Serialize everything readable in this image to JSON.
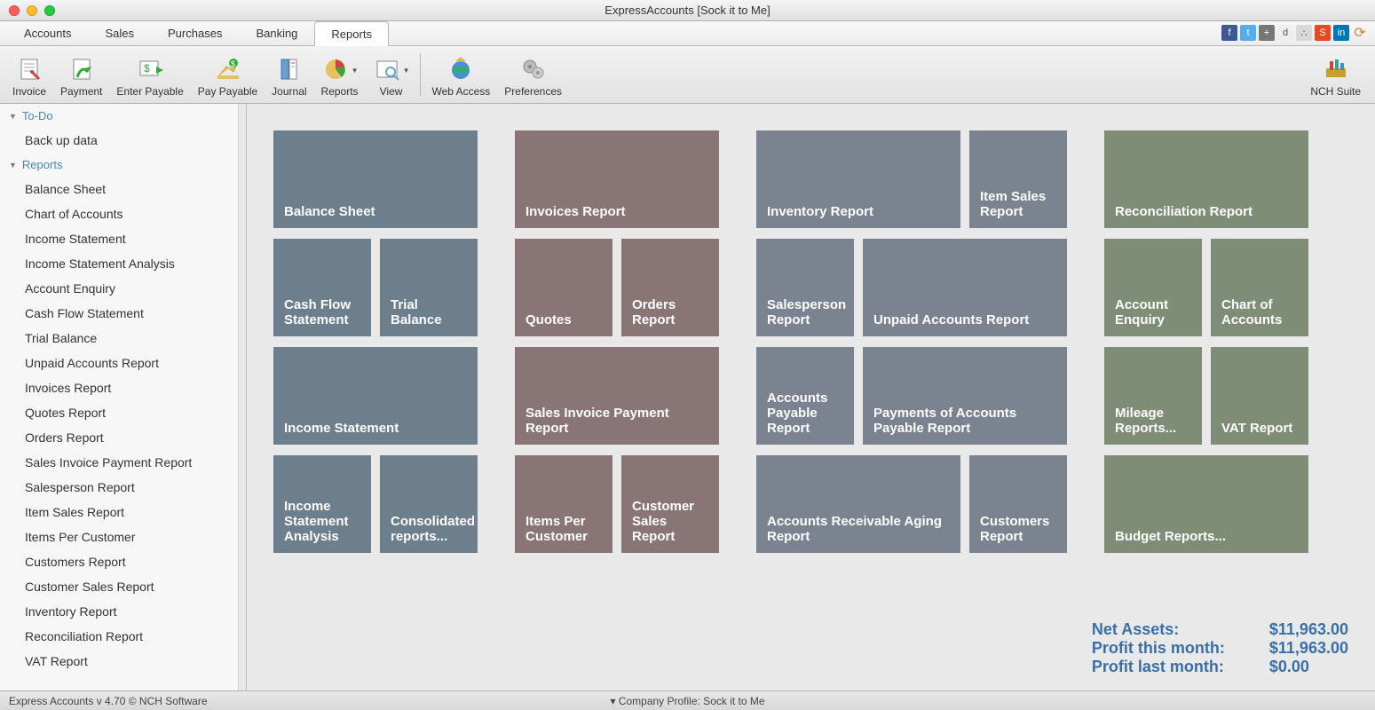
{
  "window": {
    "title": "ExpressAccounts [Sock it to Me]"
  },
  "menu": {
    "tabs": [
      {
        "label": "Accounts"
      },
      {
        "label": "Sales"
      },
      {
        "label": "Purchases"
      },
      {
        "label": "Banking"
      },
      {
        "label": "Reports"
      }
    ],
    "active": 4
  },
  "toolbar": {
    "items": [
      {
        "label": "Invoice",
        "icon": "invoice"
      },
      {
        "label": "Payment",
        "icon": "payment"
      },
      {
        "label": "Enter Payable",
        "icon": "enter-payable"
      },
      {
        "label": "Pay Payable",
        "icon": "pay-payable"
      },
      {
        "label": "Journal",
        "icon": "journal"
      },
      {
        "label": "Reports",
        "icon": "reports",
        "dropdown": true
      },
      {
        "label": "View",
        "icon": "view",
        "dropdown": true
      },
      {
        "label": "Web Access",
        "icon": "web-access"
      },
      {
        "label": "Preferences",
        "icon": "preferences"
      }
    ],
    "right": {
      "label": "NCH Suite",
      "icon": "nch-suite"
    }
  },
  "sidebar": {
    "sections": [
      {
        "title": "To-Do",
        "items": [
          "Back up data"
        ]
      },
      {
        "title": "Reports",
        "items": [
          "Balance Sheet",
          "Chart of Accounts",
          "Income Statement",
          "Income Statement Analysis",
          "Account Enquiry",
          "Cash Flow Statement",
          "Trial Balance",
          "Unpaid Accounts Report",
          "Invoices Report",
          "Quotes Report",
          "Orders Report",
          "Sales Invoice Payment Report",
          "Salesperson Report",
          "Item Sales Report",
          "Items Per Customer",
          "Customers Report",
          "Customer Sales Report",
          "Inventory Report",
          "Reconciliation Report",
          "VAT Report"
        ]
      }
    ]
  },
  "tiles": {
    "columns": [
      {
        "color": "c-blue",
        "rows": [
          [
            {
              "label": "Balance Sheet",
              "size": "wd"
            }
          ],
          [
            {
              "label": "Cash Flow Statement",
              "size": "sm"
            },
            {
              "label": "Trial Balance",
              "size": "sm"
            }
          ],
          [
            {
              "label": "Income Statement",
              "size": "wd"
            }
          ],
          [
            {
              "label": "Income Statement Analysis",
              "size": "sm"
            },
            {
              "label": "Consolidated reports...",
              "size": "sm"
            }
          ]
        ]
      },
      {
        "color": "c-brown",
        "rows": [
          [
            {
              "label": "Invoices Report",
              "size": "wd"
            }
          ],
          [
            {
              "label": "Quotes",
              "size": "sm"
            },
            {
              "label": "Orders Report",
              "size": "sm"
            }
          ],
          [
            {
              "label": "Sales Invoice Payment Report",
              "size": "wd"
            }
          ],
          [
            {
              "label": "Items Per Customer",
              "size": "sm"
            },
            {
              "label": "Customer Sales Report",
              "size": "sm"
            }
          ]
        ]
      },
      {
        "color": "c-slate",
        "rows": [
          [
            {
              "label": "Inventory Report",
              "size": "wd"
            },
            {
              "label": "Item Sales Report",
              "size": "sm"
            }
          ],
          [
            {
              "label": "Salesperson Report",
              "size": "sm"
            },
            {
              "label": "Unpaid Accounts Report",
              "size": "wd"
            }
          ],
          [
            {
              "label": "Accounts Payable Report",
              "size": "sm"
            },
            {
              "label": "Payments of Accounts Payable Report",
              "size": "wd"
            }
          ],
          [
            {
              "label": "Accounts Receivable Aging Report",
              "size": "wd"
            },
            {
              "label": "Customers Report",
              "size": "sm"
            }
          ]
        ]
      },
      {
        "color": "c-green",
        "rows": [
          [
            {
              "label": "Reconciliation Report",
              "size": "wd"
            }
          ],
          [
            {
              "label": "Account Enquiry",
              "size": "sm"
            },
            {
              "label": "Chart of Accounts",
              "size": "sm"
            }
          ],
          [
            {
              "label": "Mileage Reports...",
              "size": "sm"
            },
            {
              "label": "VAT Report",
              "size": "sm"
            }
          ],
          [
            {
              "label": "Budget Reports...",
              "size": "wd"
            }
          ]
        ]
      }
    ]
  },
  "summary": {
    "rows": [
      {
        "label": "Net Assets:",
        "value": "$11,963.00"
      },
      {
        "label": "Profit this month:",
        "value": "$11,963.00"
      },
      {
        "label": "Profit last month:",
        "value": "$0.00"
      }
    ]
  },
  "status": {
    "left": "Express Accounts v 4.70 © NCH Software",
    "center": "▾ Company Profile: Sock it to Me"
  },
  "social": [
    {
      "name": "facebook",
      "bg": "#3b5998",
      "ch": "f"
    },
    {
      "name": "twitter",
      "bg": "#55acee",
      "ch": "t"
    },
    {
      "name": "google",
      "bg": "#777",
      "ch": "+"
    },
    {
      "name": "digg",
      "bg": "#eee",
      "ch": "d"
    },
    {
      "name": "share",
      "bg": "#d9d9d9",
      "ch": "∴"
    },
    {
      "name": "stumble",
      "bg": "#eb4924",
      "ch": "S"
    },
    {
      "name": "linkedin",
      "bg": "#0077b5",
      "ch": "in"
    },
    {
      "name": "refresh",
      "bg": "transparent",
      "ch": "⟳"
    }
  ]
}
